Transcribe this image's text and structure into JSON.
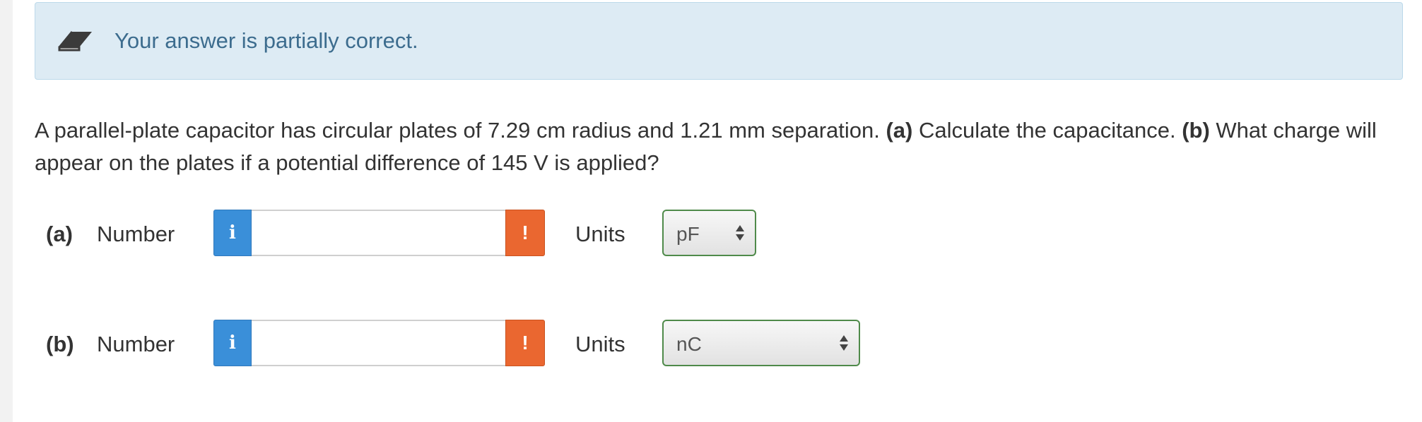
{
  "alert": {
    "message": "Your answer is partially correct.",
    "icon": "eraser-icon",
    "background_color": "#ddebf4",
    "text_color": "#3c6c8e"
  },
  "question": {
    "text_1": "A parallel-plate capacitor has circular plates of 7.29 cm radius and 1.21 mm separation. ",
    "part_a_marker": "(a)",
    "text_2": " Calculate the capacitance. ",
    "part_b_marker": "(b)",
    "text_3": " What charge will appear on the plates if a potential difference of 145 V is applied?"
  },
  "parts": [
    {
      "label": "(a)",
      "number_label": "Number",
      "info_icon_glyph": "i",
      "number_value": "",
      "warning_icon_glyph": "!",
      "units_label": "Units",
      "unit_selected": "pF"
    },
    {
      "label": "(b)",
      "number_label": "Number",
      "info_icon_glyph": "i",
      "number_value": "",
      "warning_icon_glyph": "!",
      "units_label": "Units",
      "unit_selected": "nC"
    }
  ],
  "colors": {
    "info_button": "#3a8fd9",
    "warning_button": "#ea6730",
    "select_border": "#4f8a4a"
  }
}
